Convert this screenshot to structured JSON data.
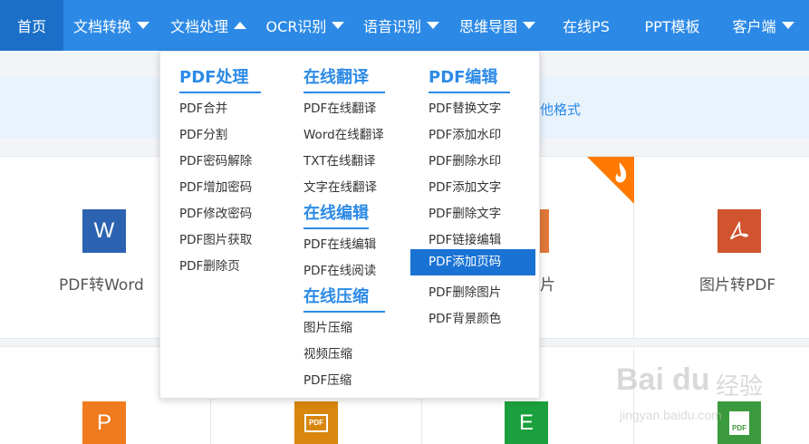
{
  "nav": {
    "items": [
      {
        "label": "首页",
        "active": true,
        "caret": "none"
      },
      {
        "label": "文档转换",
        "active": false,
        "caret": "down"
      },
      {
        "label": "文档处理",
        "active": false,
        "caret": "up"
      },
      {
        "label": "OCR识别",
        "active": false,
        "caret": "down"
      },
      {
        "label": "语音识别",
        "active": false,
        "caret": "down"
      },
      {
        "label": "思维导图",
        "active": false,
        "caret": "down"
      },
      {
        "label": "在线PS",
        "active": false,
        "caret": "none"
      },
      {
        "label": "PPT模板",
        "active": false,
        "caret": "none"
      },
      {
        "label": "客户端",
        "active": false,
        "caret": "down"
      }
    ]
  },
  "banner": {
    "text": "他格式"
  },
  "tools": {
    "row1": [
      {
        "label": "PDF转Word",
        "icon": "word-icon",
        "icon_text": "W",
        "color": "#2b63b0"
      },
      {
        "label": "片",
        "icon": "image-icon",
        "color": "#e2783a"
      },
      {
        "label": "图片转PDF",
        "icon": "pdf-icon",
        "color": "#d0542e"
      }
    ],
    "row2": [
      {
        "icon": "ppt-icon",
        "icon_text": "P",
        "color": "#f07b1e"
      },
      {
        "icon": "pdf-slide-icon",
        "icon_text": "PDF",
        "color": "#d8860e"
      },
      {
        "icon": "excel-icon",
        "icon_text": "E",
        "color": "#1aa03c"
      },
      {
        "icon": "pdf-file-icon",
        "icon_text": "PDF",
        "color": "#3b9a3e"
      }
    ]
  },
  "dropdown": {
    "col1": {
      "heading": "PDF处理",
      "items": [
        "PDF合并",
        "PDF分割",
        "PDF密码解除",
        "PDF增加密码",
        "PDF修改密码",
        "PDF图片获取",
        "PDF删除页"
      ]
    },
    "col2": {
      "heading1": "在线翻译",
      "items1": [
        "PDF在线翻译",
        "Word在线翻译",
        "TXT在线翻译",
        "文字在线翻译"
      ],
      "heading2": "在线编辑",
      "items2": [
        "PDF在线编辑",
        "PDF在线阅读"
      ],
      "heading3": "在线压缩",
      "items3": [
        "图片压缩",
        "视频压缩",
        "PDF压缩"
      ]
    },
    "col3": {
      "heading": "PDF编辑",
      "items": [
        "PDF替换文字",
        "PDF添加水印",
        "PDF删除水印",
        "PDF添加文字",
        "PDF删除文字",
        "PDF链接编辑",
        "PDF添加页码",
        "PDF删除图片",
        "PDF背景颜色"
      ],
      "highlighted": "PDF添加页码"
    }
  },
  "watermark": {
    "brand": "Bai",
    "brand2": "du",
    "brand_cn": "经验",
    "url": "jingyan.baidu.com"
  },
  "colors": {
    "nav_bg": "#2c8ae6",
    "nav_active": "#1b6fc9",
    "accent": "#2c8ae6",
    "highlight": "#1a73d4",
    "hot": "#ff7a00"
  }
}
